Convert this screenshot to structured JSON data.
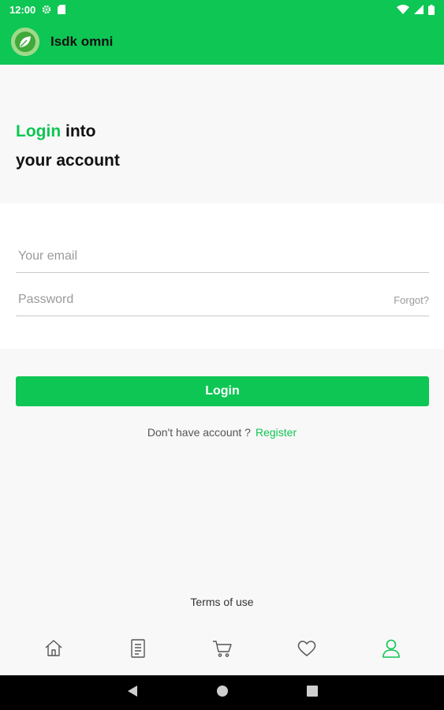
{
  "status_bar": {
    "time": "12:00"
  },
  "app_bar": {
    "title": "Isdk omni"
  },
  "heading": {
    "accent": "Login",
    "rest_line1": " into",
    "line2": "your account"
  },
  "form": {
    "email_placeholder": "Your email",
    "password_placeholder": "Password",
    "forgot_label": "Forgot?"
  },
  "login_button_label": "Login",
  "register": {
    "prompt": "Don't have account ?",
    "link": "Register"
  },
  "terms_label": "Terms of use",
  "bottom_nav": {
    "items": [
      {
        "icon": "home-icon",
        "active": false
      },
      {
        "icon": "document-icon",
        "active": false
      },
      {
        "icon": "cart-icon",
        "active": false
      },
      {
        "icon": "heart-icon",
        "active": false
      },
      {
        "icon": "user-icon",
        "active": true
      }
    ]
  },
  "colors": {
    "brand": "#0ec653",
    "icon_inactive": "#555555",
    "text_muted": "#9a9a9a"
  }
}
